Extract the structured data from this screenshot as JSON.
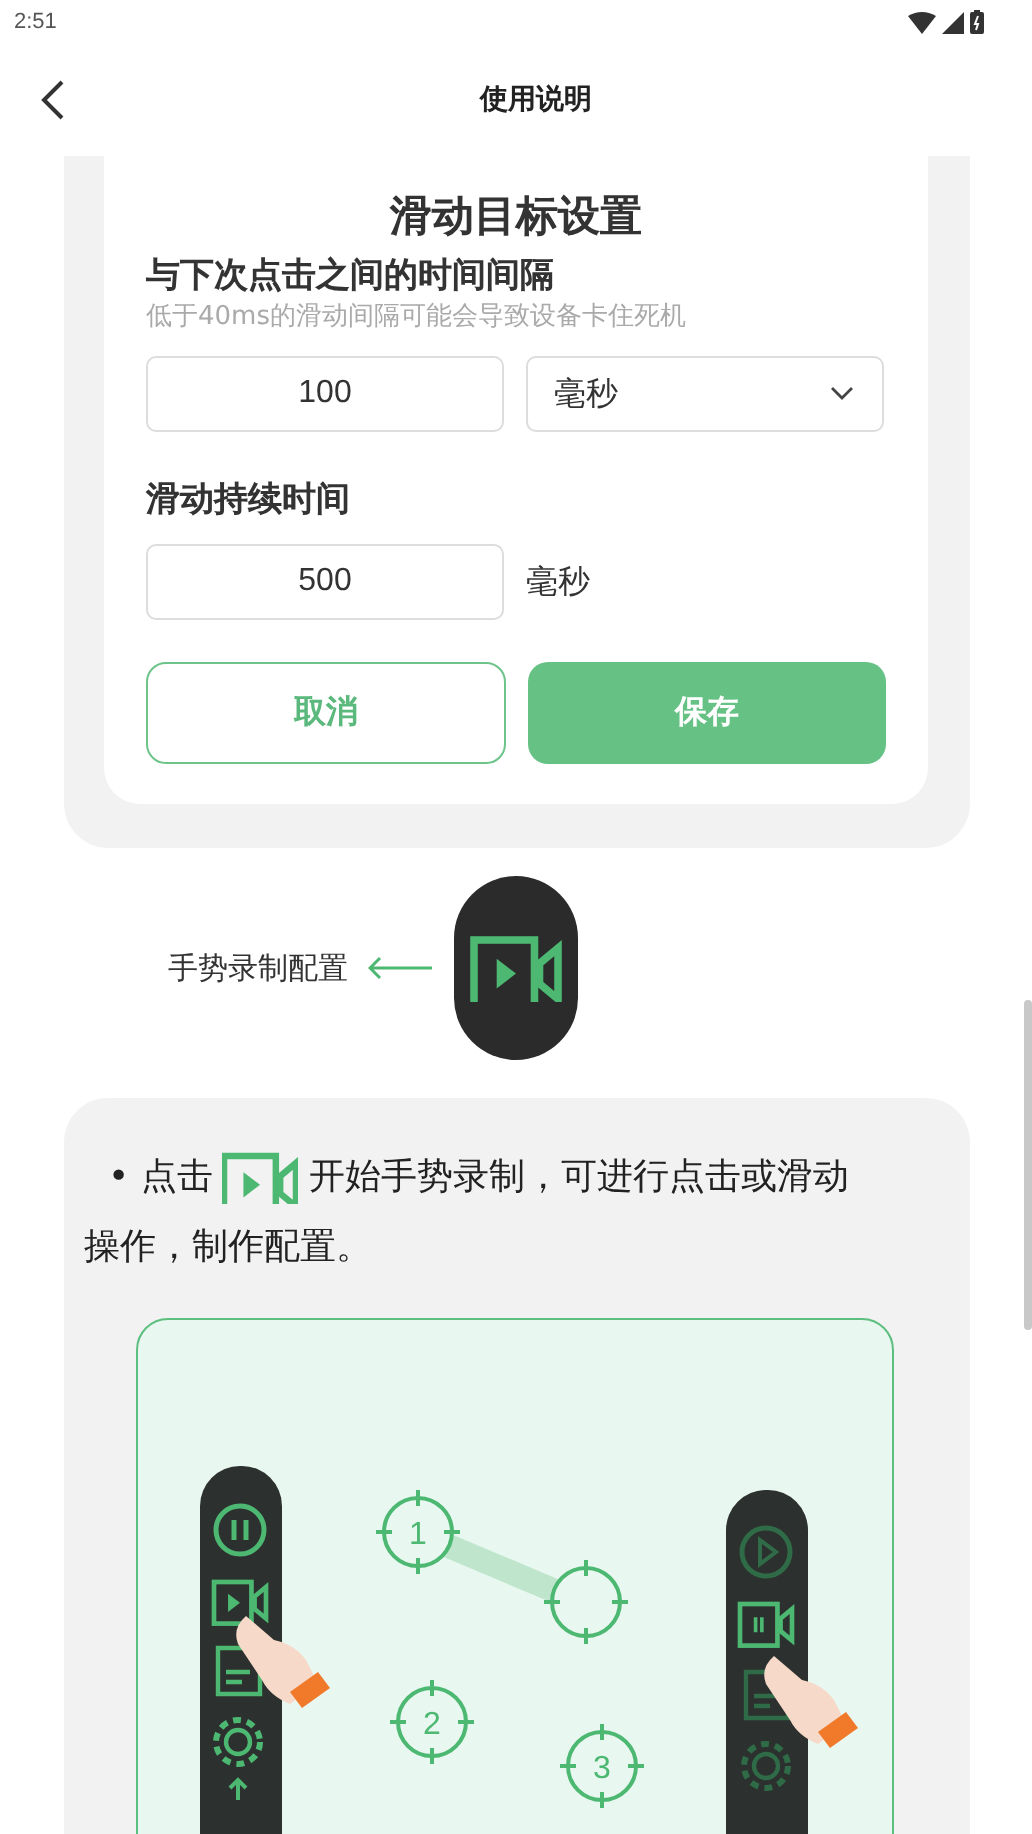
{
  "status_bar": {
    "time": "2:51"
  },
  "header": {
    "title": "使用说明"
  },
  "dialog": {
    "title": "滑动目标设置",
    "fields": [
      {
        "label": "与下次点击之间的时间间隔",
        "hint": "低于40ms的滑动间隔可能会导致设备卡住死机",
        "value": "100",
        "unit": {
          "kind": "dropdown",
          "text": "毫秒"
        }
      },
      {
        "label": "滑动持续时间",
        "value": "500",
        "unit": {
          "kind": "text",
          "text": "毫秒"
        }
      }
    ],
    "buttons": [
      {
        "label": "取消",
        "kind": "outline"
      },
      {
        "label": "保存",
        "kind": "filled"
      }
    ]
  },
  "gesture_hint": {
    "label": "手势录制配置"
  },
  "instructions": {
    "bullet": "•",
    "text_before": "点击",
    "text_after": [
      "开始手势录制，可进行点击或滑动",
      "操作，制作配置。"
    ],
    "illustration": {
      "targets": [
        {
          "number": "1"
        },
        {
          "number": "2"
        },
        {
          "number": "3"
        }
      ]
    }
  }
}
